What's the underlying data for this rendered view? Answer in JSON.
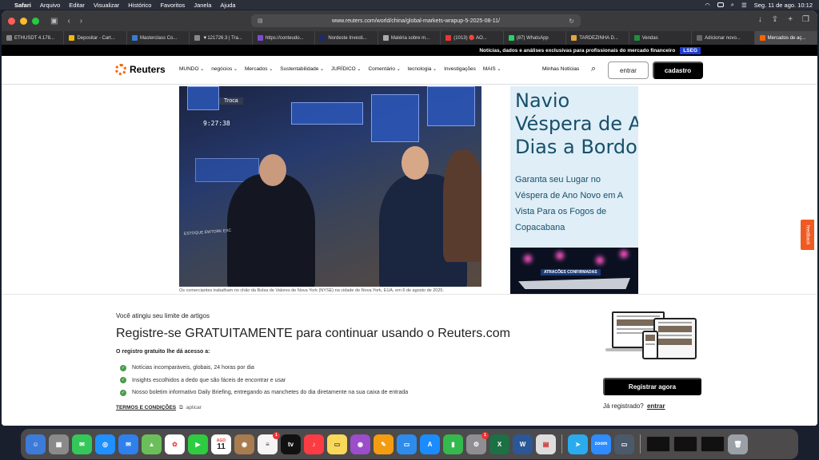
{
  "menubar": {
    "apple": "",
    "items": [
      "Safari",
      "Arquivo",
      "Editar",
      "Visualizar",
      "Histórico",
      "Favoritos",
      "Janela",
      "Ajuda"
    ],
    "clock": "Seg. 11 de ago.  10:12"
  },
  "browser": {
    "url": "www.reuters.com/world/china/global-markets-wrapup-5-2025-08-11/",
    "tabs": [
      {
        "label": "ETHUSDT 4.178..."
      },
      {
        "label": "Depositar - Cart..."
      },
      {
        "label": "Masterclass Co..."
      },
      {
        "label": "▼121726.3 | Tra..."
      },
      {
        "label": "https://conteudo..."
      },
      {
        "label": "Nordeste Investi..."
      },
      {
        "label": "Matéria sobre m..."
      },
      {
        "label": "(1013) 🔴 AO..."
      },
      {
        "label": "(87) WhatsApp"
      },
      {
        "label": "TARDEZINHA D..."
      },
      {
        "label": "Vendas"
      },
      {
        "label": "Adicionar novo..."
      },
      {
        "label": "Mercados de aç..."
      }
    ]
  },
  "reuters": {
    "promo": "Notícias, dados e análises exclusivas para profissionais do mercado financeiro",
    "promo_badge": "LSEG",
    "logo": "Reuters",
    "nav": [
      "MUNDO",
      "negócios",
      "Mercados",
      "Sustentabilidade",
      "JURÍDICO",
      "Comentário",
      "tecnologia",
      "Investigações",
      "MAIS"
    ],
    "minhas": "Minhas Notícias",
    "login": "entrar",
    "signup": "cadastro",
    "photo": {
      "board": "Troca",
      "ticker": "9:27:38",
      "credit": "ESTOQUE EWTORK EXC"
    },
    "caption": "Os comerciantes trabalham no chão da Bolsa de Valores de Nova York (NYSE) na cidade de Nova York, EUA, em 6 de agosto de 2025.",
    "ad": {
      "big": [
        "Navio",
        "Véspera de Ano",
        "Dias a Bordo"
      ],
      "small": [
        "Garanta seu Lugar no",
        "Véspera de Ano Novo em A",
        "Vista Para os Fogos de",
        "Copacabana"
      ],
      "banner_label": "ATRACÕES CONFIRMADAS"
    },
    "feedback": "feedback"
  },
  "paywall": {
    "limit": "Você atingiu seu limite de artigos",
    "title": "Registre-se GRATUITAMENTE para continuar usando o Reuters.com",
    "sub": "O registro gratuito lhe dá acesso a:",
    "benefits": [
      "Notícias incomparáveis, globais, 24 horas por dia",
      "Insights escolhidos a dedo que são fáceis de encontrar e usar",
      "Nosso boletim informativo Daily Briefing, entregando as manchetes do dia diretamente na sua caixa de entrada"
    ],
    "terms": "TERMOS E CONDIÇÕES",
    "apply": "aplicar",
    "register_button": "Registrar agora",
    "already": "Já registrado?",
    "login_link": "entrar"
  },
  "dock": {
    "calendar_month": "AGO",
    "calendar_day": "11",
    "badges": {
      "mail": "1",
      "settings": "1"
    }
  }
}
